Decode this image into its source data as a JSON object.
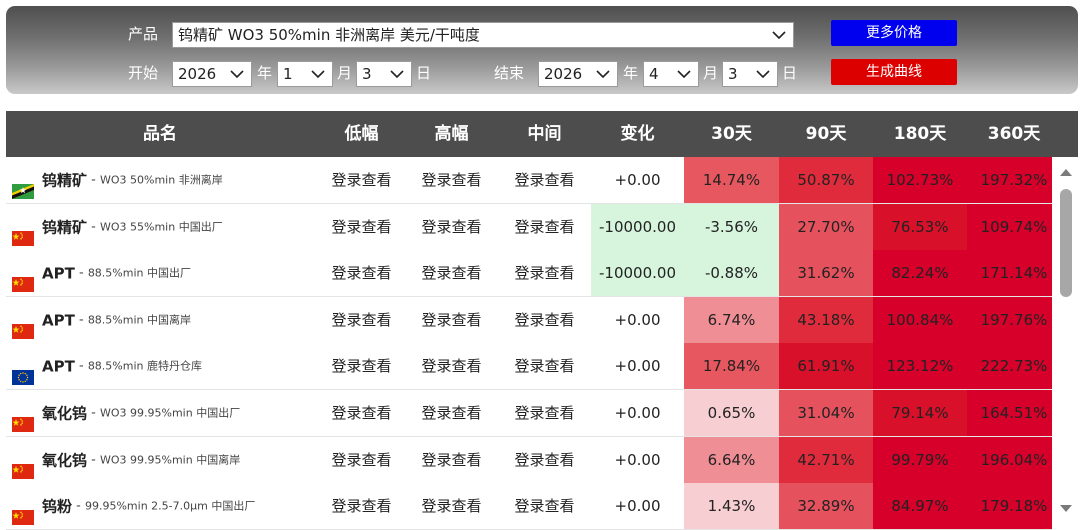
{
  "controls": {
    "product_label": "产品",
    "product_value": "钨精矿 WO3 50%min 非洲离岸 美元/干吨度",
    "start_label": "开始",
    "end_label": "结束",
    "start": {
      "year": "2026",
      "month": "1",
      "day": "3"
    },
    "end": {
      "year": "2026",
      "month": "4",
      "day": "3"
    },
    "year_unit": "年",
    "month_unit": "月",
    "day_unit": "日",
    "more_prices_button": "更多价格",
    "generate_chart_button": "生成曲线"
  },
  "table": {
    "headers": [
      "品名",
      "低幅",
      "高幅",
      "中间",
      "变化",
      "30天",
      "90天",
      "180天",
      "360天"
    ],
    "login_text": "登录查看",
    "rows": [
      {
        "flag": "african",
        "name": "钨精矿",
        "desc": "WO3 50%min 非洲离岸",
        "change": "+0.00",
        "d30": "14.74%",
        "d90": "50.87%",
        "d180": "102.73%",
        "d360": "197.32%"
      },
      {
        "flag": "china",
        "name": "钨精矿",
        "desc": "WO3 55%min 中国出厂",
        "change": "-10000.00",
        "d30": "-3.56%",
        "d90": "27.70%",
        "d180": "76.53%",
        "d360": "109.74%"
      },
      {
        "flag": "china",
        "name": "APT",
        "desc": "88.5%min 中国出厂",
        "change": "-10000.00",
        "d30": "-0.88%",
        "d90": "31.62%",
        "d180": "82.24%",
        "d360": "171.14%"
      },
      {
        "flag": "china",
        "name": "APT",
        "desc": "88.5%min 中国离岸",
        "change": "+0.00",
        "d30": "6.74%",
        "d90": "43.18%",
        "d180": "100.84%",
        "d360": "197.76%"
      },
      {
        "flag": "eu",
        "name": "APT",
        "desc": "88.5%min 鹿特丹仓库",
        "change": "+0.00",
        "d30": "17.84%",
        "d90": "61.91%",
        "d180": "123.12%",
        "d360": "222.73%"
      },
      {
        "flag": "china",
        "name": "氧化钨",
        "desc": "WO3 99.95%min 中国出厂",
        "change": "+0.00",
        "d30": "0.65%",
        "d90": "31.04%",
        "d180": "79.14%",
        "d360": "164.51%"
      },
      {
        "flag": "china",
        "name": "氧化钨",
        "desc": "WO3 99.95%min 中国离岸",
        "change": "+0.00",
        "d30": "6.64%",
        "d90": "42.71%",
        "d180": "99.79%",
        "d360": "196.04%"
      },
      {
        "flag": "china",
        "name": "钨粉",
        "desc": "99.95%min 2.5-7.0μm 中国出厂",
        "change": "+0.00",
        "d30": "1.43%",
        "d90": "32.89%",
        "d180": "84.97%",
        "d360": "179.18%"
      }
    ]
  },
  "colors": {
    "header_bg": "#4d4d4d",
    "blue_button": "#0000ee",
    "red_button": "#dd0000",
    "negative_change_bg": "#d6f5dc",
    "positive_heat": [
      "#f7cfd3",
      "#e7575f",
      "#d6002a"
    ]
  }
}
